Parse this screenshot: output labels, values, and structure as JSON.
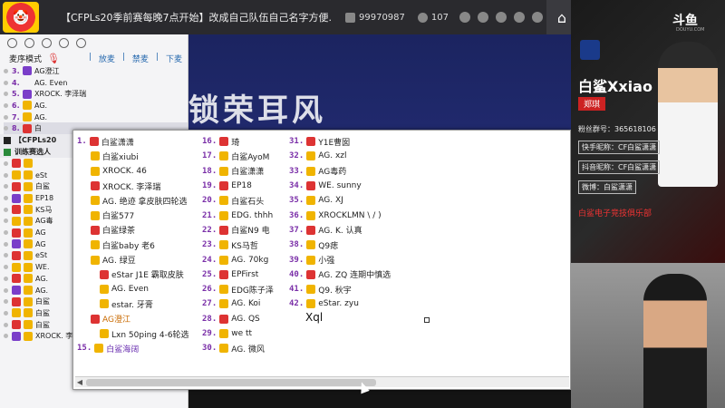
{
  "topbar": {
    "title": "【CFPLs20季前赛每晚7点开始】改成自己队伍自己名字方便...",
    "room_id": "99970987",
    "viewers": "107"
  },
  "sidebar": {
    "mic_mode": "麦序模式",
    "links": [
      "|",
      "放麦",
      "|",
      "禁麦",
      "|",
      "下麦"
    ],
    "top_rows": [
      {
        "num": "3.",
        "name": "AG澄江",
        "badge": "purple"
      },
      {
        "num": "4.",
        "name": "AG. Even",
        "badge": "none"
      },
      {
        "num": "5.",
        "name": "XROCK. 李泽瑞",
        "badge": "purple"
      },
      {
        "num": "6.",
        "name": "AG.",
        "badge": "gold"
      },
      {
        "num": "7.",
        "name": "AG.",
        "badge": "gold"
      },
      {
        "num": "8.",
        "name": "白",
        "badge": "red"
      }
    ],
    "section1": "【CFPLs20",
    "section2": "训练赛选人",
    "rows": [
      "",
      "eSt",
      "白鲨",
      "EP18",
      "KS马",
      "AG毒",
      "AG",
      "AG",
      "eSt",
      "WE.",
      "AG.",
      "AG.",
      "白鲨",
      "白鲨",
      "白鲨",
      "XROCK. 李泽瑞"
    ]
  },
  "stream": {
    "banner": "锁荣耳风"
  },
  "popup": {
    "col1": [
      {
        "n": "1.",
        "name": "白鲨潇潇",
        "cls": "",
        "indent": 0
      },
      {
        "n": "",
        "name": "白鲨xiubi",
        "cls": "",
        "indent": 1
      },
      {
        "n": "",
        "name": "XROCK. 46",
        "cls": "",
        "indent": 1
      },
      {
        "n": "",
        "name": "XROCK. 李泽瑞",
        "cls": "",
        "indent": 1
      },
      {
        "n": "",
        "name": "AG. 绝迹 拿皮肤四轮选",
        "cls": "",
        "indent": 1
      },
      {
        "n": "",
        "name": "白鲨577",
        "cls": "",
        "indent": 1
      },
      {
        "n": "",
        "name": "白鲨绿茶",
        "cls": "",
        "indent": 1
      },
      {
        "n": "",
        "name": "白鲨baby 老6",
        "cls": "",
        "indent": 1
      },
      {
        "n": "",
        "name": "AG. 绿豆",
        "cls": "",
        "indent": 1
      },
      {
        "n": "",
        "name": "eStar J1E 霸取皮肤",
        "cls": "",
        "indent": 2
      },
      {
        "n": "",
        "name": "AG. Even",
        "cls": "",
        "indent": 2
      },
      {
        "n": "",
        "name": "estar. 牙膏",
        "cls": "",
        "indent": 2
      },
      {
        "n": "",
        "name": "AG澄江",
        "cls": "orange",
        "indent": 1
      },
      {
        "n": "",
        "name": "Lxn 50ping 4-6轮选",
        "cls": "",
        "indent": 2
      },
      {
        "n": "15.",
        "name": "白鲨海阔",
        "cls": "purple",
        "indent": 0
      }
    ],
    "col2": [
      {
        "n": "16.",
        "name": "琦"
      },
      {
        "n": "17.",
        "name": "白鲨AyoM"
      },
      {
        "n": "18.",
        "name": "白鲨潇潇"
      },
      {
        "n": "19.",
        "name": "EP18"
      },
      {
        "n": "20.",
        "name": "白鲨石头"
      },
      {
        "n": "21.",
        "name": "EDG. thhh"
      },
      {
        "n": "22.",
        "name": "白鲨N9 电"
      },
      {
        "n": "23.",
        "name": "KS马哲"
      },
      {
        "n": "24.",
        "name": "AG. 70kg"
      },
      {
        "n": "25.",
        "name": "EPFirst"
      },
      {
        "n": "26.",
        "name": "EDG陈子泽"
      },
      {
        "n": "27.",
        "name": "AG. Koi"
      },
      {
        "n": "28.",
        "name": "AG. QS"
      },
      {
        "n": "29.",
        "name": "we tt"
      },
      {
        "n": "30.",
        "name": "AG. 微风"
      }
    ],
    "col3": [
      {
        "n": "31.",
        "name": "Y1E曹囡"
      },
      {
        "n": "32.",
        "name": "AG. xzl"
      },
      {
        "n": "33.",
        "name": "AG毒药"
      },
      {
        "n": "34.",
        "name": "WE. sunny"
      },
      {
        "n": "35.",
        "name": "AG. XJ"
      },
      {
        "n": "36.",
        "name": "XROCKLMN \\ / )"
      },
      {
        "n": "37.",
        "name": "AG. K. 认真"
      },
      {
        "n": "38.",
        "name": "Q9痣"
      },
      {
        "n": "39.",
        "name": "小强"
      },
      {
        "n": "40.",
        "name": "AG. ZQ 连期中慎选"
      },
      {
        "n": "41.",
        "name": "Q9. 秋宇"
      },
      {
        "n": "42.",
        "name": "eStar. zyu"
      }
    ],
    "xql": "Xql"
  },
  "right": {
    "douyu": "斗鱼",
    "douyu_sub": "DOUYU.COM",
    "name": "白鲨Xxiao",
    "real_name": "郑琪",
    "fans": "粉丝群号：365618106",
    "kuaishou": "快手昵称：CF白鲨潇潇",
    "douyin": "抖音昵称：CF白鲨潇潇",
    "weibo": "微博：白鲨潇潇",
    "club": "白鲨电子竞技俱乐部"
  }
}
